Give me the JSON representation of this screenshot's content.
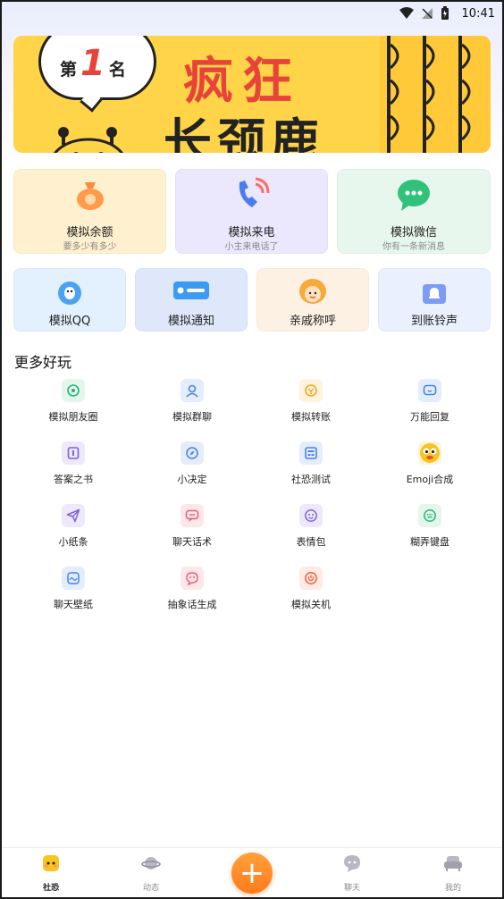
{
  "status_bar": {
    "time": "10:41"
  },
  "banner": {
    "rank_prefix": "第",
    "rank_number": "1",
    "rank_suffix": "名",
    "line1": "疯狂",
    "line2": "长颈鹿"
  },
  "feature_cards": [
    {
      "title": "模拟余额",
      "subtitle": "要多少有多少",
      "bg": "#fff0cf",
      "icon": "money-bag-icon"
    },
    {
      "title": "模拟来电",
      "subtitle": "小主来电话了",
      "bg": "#ebe8fd",
      "icon": "phone-call-icon"
    },
    {
      "title": "模拟微信",
      "subtitle": "你有一条新消息",
      "bg": "#e8f7ee",
      "icon": "wechat-icon"
    }
  ],
  "small_cards": [
    {
      "title": "模拟QQ",
      "icon": "qq-icon"
    },
    {
      "title": "模拟通知",
      "icon": "notification-icon"
    },
    {
      "title": "亲戚称呼",
      "icon": "relative-avatar-icon"
    },
    {
      "title": "到账铃声",
      "icon": "bell-icon"
    }
  ],
  "section_title": "更多好玩",
  "tools": [
    {
      "label": "模拟朋友圈",
      "icon": "moments-icon",
      "color": "#22b573"
    },
    {
      "label": "模拟群聊",
      "icon": "group-chat-icon",
      "color": "#4a82e8"
    },
    {
      "label": "模拟转账",
      "icon": "transfer-icon",
      "color": "#f2a91a"
    },
    {
      "label": "万能回复",
      "icon": "reply-icon",
      "color": "#4a82e8"
    },
    {
      "label": "答案之书",
      "icon": "book-icon",
      "color": "#7d62d8"
    },
    {
      "label": "小决定",
      "icon": "compass-icon",
      "color": "#4a82e8"
    },
    {
      "label": "社恐测试",
      "icon": "test-icon",
      "color": "#4a82e8"
    },
    {
      "label": "Emoji合成",
      "icon": "emoji-icon",
      "color": "#f2c31a"
    },
    {
      "label": "小纸条",
      "icon": "paper-plane-icon",
      "color": "#7d62d8"
    },
    {
      "label": "聊天话术",
      "icon": "chat-script-icon",
      "color": "#ef5a6a"
    },
    {
      "label": "表情包",
      "icon": "sticker-icon",
      "color": "#7d62d8"
    },
    {
      "label": "糊弄键盘",
      "icon": "keyboard-icon",
      "color": "#22b573"
    },
    {
      "label": "聊天壁纸",
      "icon": "wallpaper-icon",
      "color": "#4a82e8"
    },
    {
      "label": "抽象话生成",
      "icon": "abstract-talk-icon",
      "color": "#ef5a6a"
    },
    {
      "label": "模拟关机",
      "icon": "power-icon",
      "color": "#ef5a3a"
    }
  ],
  "bottom_nav": [
    {
      "label": "社恐",
      "icon": "social-face-icon"
    },
    {
      "label": "动态",
      "icon": "planet-icon"
    },
    {
      "label": "聊天",
      "icon": "chat-bubble-icon"
    },
    {
      "label": "我的",
      "icon": "sofa-icon"
    }
  ],
  "fab": {
    "label": "+"
  }
}
